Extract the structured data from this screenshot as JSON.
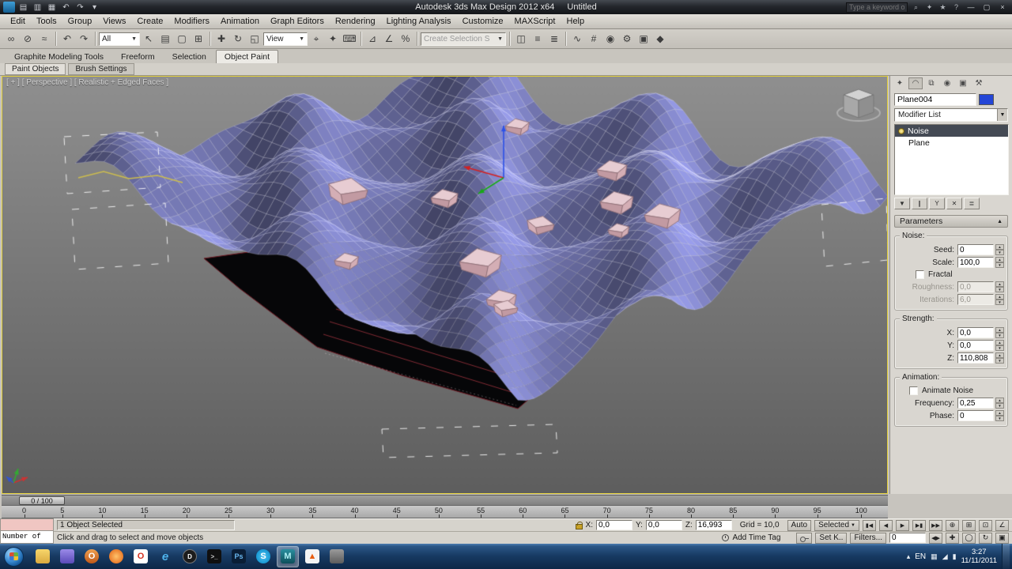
{
  "title_bar": {
    "app_title": "Autodesk 3ds Max Design 2012 x64",
    "document": "Untitled",
    "search_placeholder": "Type a keyword or phrase"
  },
  "menu_bar": {
    "items": [
      "Edit",
      "Tools",
      "Group",
      "Views",
      "Create",
      "Modifiers",
      "Animation",
      "Graph Editors",
      "Rendering",
      "Lighting Analysis",
      "Customize",
      "MAXScript",
      "Help"
    ]
  },
  "toolbar": {
    "selection_filter": "All",
    "reference_coordinate": "View",
    "create_selection_set": "Create Selection S"
  },
  "ribbon": {
    "tabs": [
      {
        "label": "Graphite Modeling Tools"
      },
      {
        "label": "Freeform"
      },
      {
        "label": "Selection"
      },
      {
        "label": "Object Paint",
        "active": true
      }
    ],
    "panel_tabs": [
      {
        "label": "Paint Objects",
        "active": true
      },
      {
        "label": "Brush Settings"
      }
    ]
  },
  "viewport": {
    "label": "[ + ] [ Perspective ] [ Realistic + Edged Faces ]"
  },
  "command_panel": {
    "object_name": "Plane004",
    "modifier_list": "Modifier List",
    "stack": [
      {
        "label": "Noise",
        "active": true
      },
      {
        "label": "Plane"
      }
    ],
    "rollout_title": "Parameters",
    "noise_group": {
      "title": "Noise:",
      "seed_label": "Seed:",
      "seed": "0",
      "scale_label": "Scale:",
      "scale": "100,0",
      "fractal_label": "Fractal",
      "roughness_label": "Roughness:",
      "roughness": "0,0",
      "iterations_label": "Iterations:",
      "iterations": "6,0"
    },
    "strength_group": {
      "title": "Strength:",
      "x_label": "X:",
      "x": "0,0",
      "y_label": "Y:",
      "y": "0,0",
      "z_label": "Z:",
      "z": "110,808"
    },
    "animation_group": {
      "title": "Animation:",
      "animate_label": "Animate Noise",
      "frequency_label": "Frequency:",
      "frequency": "0,25",
      "phase_label": "Phase:",
      "phase": "0"
    }
  },
  "timeline": {
    "slider_label": "0 / 100",
    "ticks": [
      "0",
      "5",
      "10",
      "15",
      "20",
      "25",
      "30",
      "35",
      "40",
      "45",
      "50",
      "55",
      "60",
      "65",
      "70",
      "75",
      "80",
      "85",
      "90",
      "95",
      "100"
    ]
  },
  "status_bar": {
    "mini_listener": "Number of",
    "selection_status": "1 Object Selected",
    "prompt": "Click and drag to select and move objects",
    "x_label": "X:",
    "x_value": "0,0",
    "y_label": "Y:",
    "y_value": "0,0",
    "z_label": "Z:",
    "z_value": "16,993",
    "grid": "Grid = 10,0",
    "add_time_tag": "Add Time Tag",
    "auto_key": "Auto",
    "selected_mode": "Selected",
    "set_key": "Set K..",
    "key_filters": "Filters...",
    "frame": "0"
  },
  "taskbar": {
    "language": "EN",
    "time": "3:27",
    "date": "11/11/2011"
  }
}
